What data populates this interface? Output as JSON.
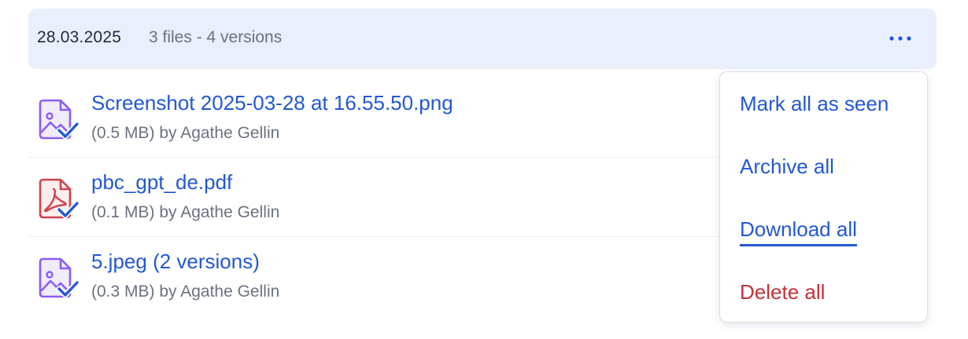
{
  "group": {
    "date": "28.03.2025",
    "summary": "3 files - 4 versions",
    "more_icon": "ellipsis-icon"
  },
  "files": [
    {
      "name": "Screenshot 2025-03-28 at 16.55.50.png",
      "meta": "(0.5 MB) by Agathe Gellin",
      "icon": "image-file-icon",
      "seen": true
    },
    {
      "name": "pbc_gpt_de.pdf",
      "meta": "(0.1 MB) by Agathe Gellin",
      "icon": "pdf-file-icon",
      "seen": true
    },
    {
      "name": "5.jpeg (2 versions)",
      "meta": "(0.3 MB) by Agathe Gellin",
      "icon": "image-file-icon",
      "seen": true
    }
  ],
  "menu": {
    "items": [
      {
        "label": "Mark all as seen"
      },
      {
        "label": "Archive all"
      },
      {
        "label": "Download all"
      },
      {
        "label": "Delete all"
      }
    ]
  },
  "colors": {
    "header_bg": "#e9effb",
    "link": "#2358d1",
    "danger": "#c5303a",
    "muted": "#6b7280",
    "image_icon": "#8b5cf6",
    "pdf_icon": "#d0414b",
    "check": "#2358d1"
  }
}
